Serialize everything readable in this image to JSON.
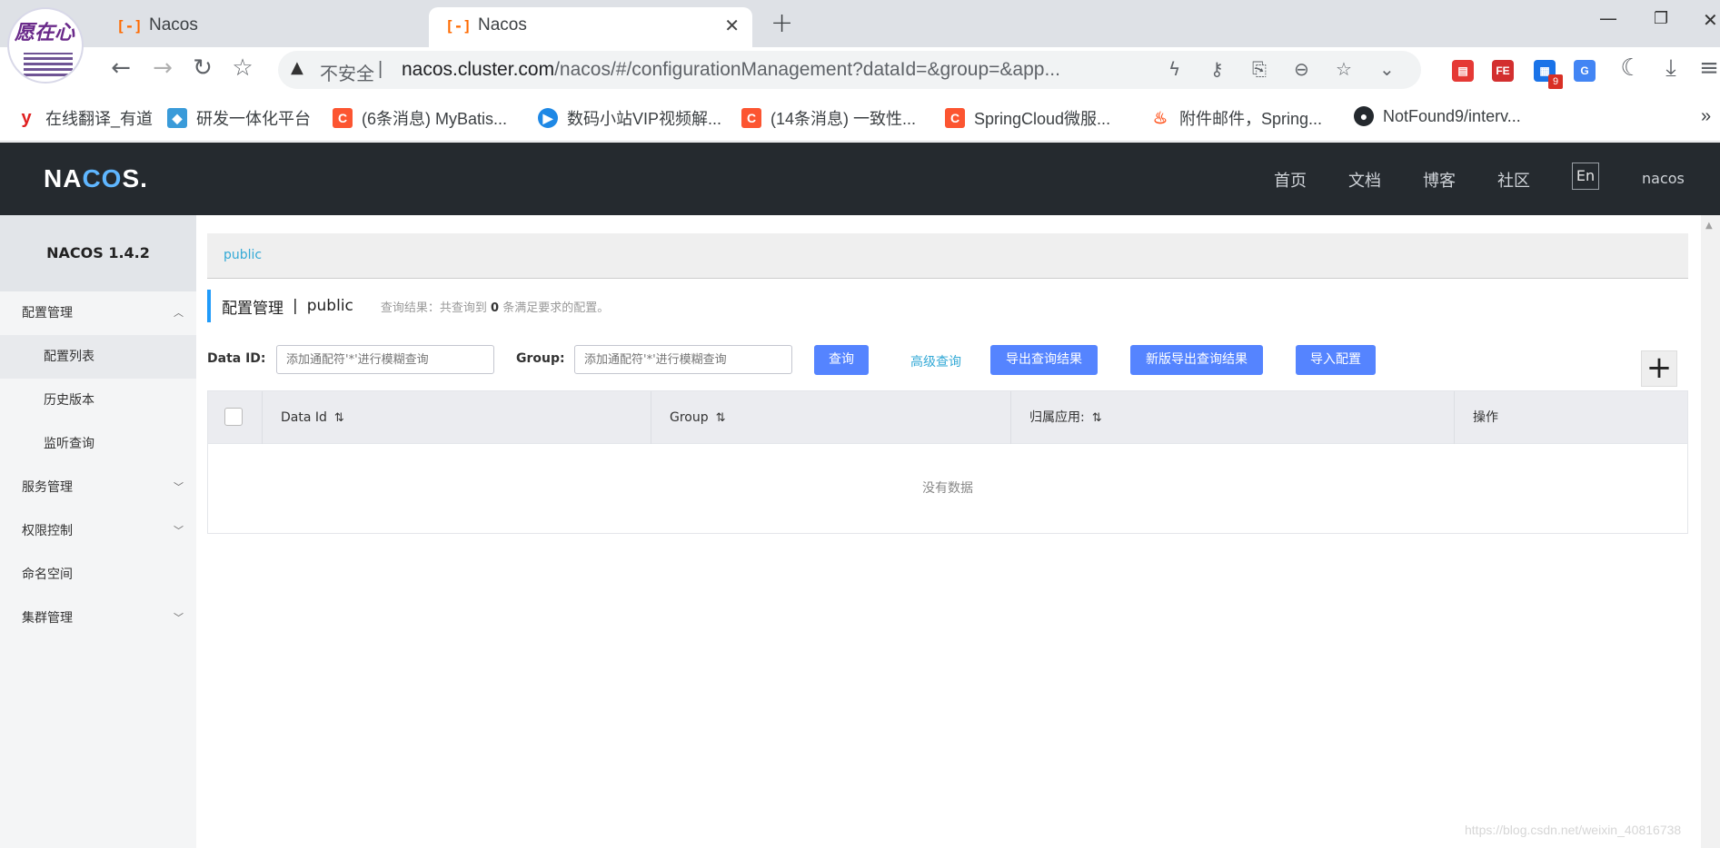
{
  "browser": {
    "tabs": [
      {
        "title": "Nacos",
        "active": false
      },
      {
        "title": "Nacos",
        "active": true
      }
    ],
    "tab_close": "✕",
    "new_tab": "+",
    "address": {
      "security_label": "不安全",
      "url_host": "nacos.cluster.com",
      "url_path": "/nacos/#/configurationManagement?dataId=&group=&app..."
    },
    "extension_badge": "9",
    "bookmarks": [
      {
        "label": "在线翻译_有道",
        "icon": "youdao-icon",
        "color": "#e02020"
      },
      {
        "label": "研发一体化平台",
        "icon": "cube-icon",
        "color": "#3a9bd9"
      },
      {
        "label": "(6条消息) MyBatis...",
        "icon": "csdn-icon",
        "color": "#fc5531"
      },
      {
        "label": "数码小站VIP视频解...",
        "icon": "play-icon",
        "color": "#1e88e5"
      },
      {
        "label": "(14条消息) 一致性...",
        "icon": "csdn-icon",
        "color": "#fc5531"
      },
      {
        "label": "SpringCloud微服...",
        "icon": "csdn-icon",
        "color": "#fc5531"
      },
      {
        "label": "附件邮件，Spring...",
        "icon": "fire-icon",
        "color": "#ff5722"
      },
      {
        "label": "NotFound9/interv...",
        "icon": "github-icon",
        "color": "#24292e"
      }
    ],
    "more": "»"
  },
  "nacos": {
    "logo": "NACOS.",
    "nav": [
      "首页",
      "文档",
      "博客",
      "社区"
    ],
    "lang": "En",
    "user": "nacos"
  },
  "sidebar": {
    "version": "NACOS 1.4.2",
    "items": [
      {
        "label": "配置管理",
        "sub": false,
        "chevron": "up"
      },
      {
        "label": "配置列表",
        "sub": true,
        "selected": true
      },
      {
        "label": "历史版本",
        "sub": true
      },
      {
        "label": "监听查询",
        "sub": true
      },
      {
        "label": "服务管理",
        "sub": false,
        "chevron": "down"
      },
      {
        "label": "权限控制",
        "sub": false,
        "chevron": "down"
      },
      {
        "label": "命名空间",
        "sub": false
      },
      {
        "label": "集群管理",
        "sub": false,
        "chevron": "down"
      }
    ]
  },
  "main": {
    "namespace_tab": "public",
    "title": "配置管理",
    "separator": "|",
    "namespace": "public",
    "result_prefix": "查询结果：共查询到",
    "result_count": "0",
    "result_suffix": "条满足要求的配置。",
    "filters": {
      "data_id_label": "Data ID:",
      "data_id_placeholder": "添加通配符'*'进行模糊查询",
      "group_label": "Group:",
      "group_placeholder": "添加通配符'*'进行模糊查询"
    },
    "buttons": {
      "query": "查询",
      "advanced": "高级查询",
      "export": "导出查询结果",
      "export_new": "新版导出查询结果",
      "import": "导入配置",
      "add": "+"
    },
    "table": {
      "columns": [
        "Data Id",
        "Group",
        "归属应用:",
        "操作"
      ],
      "empty": "没有数据"
    }
  },
  "watermark": "https://blog.csdn.net/weixin_40816738",
  "colors": {
    "primary": "#5584ff",
    "link": "#33a9d6",
    "header_bg": "#252a2f"
  }
}
